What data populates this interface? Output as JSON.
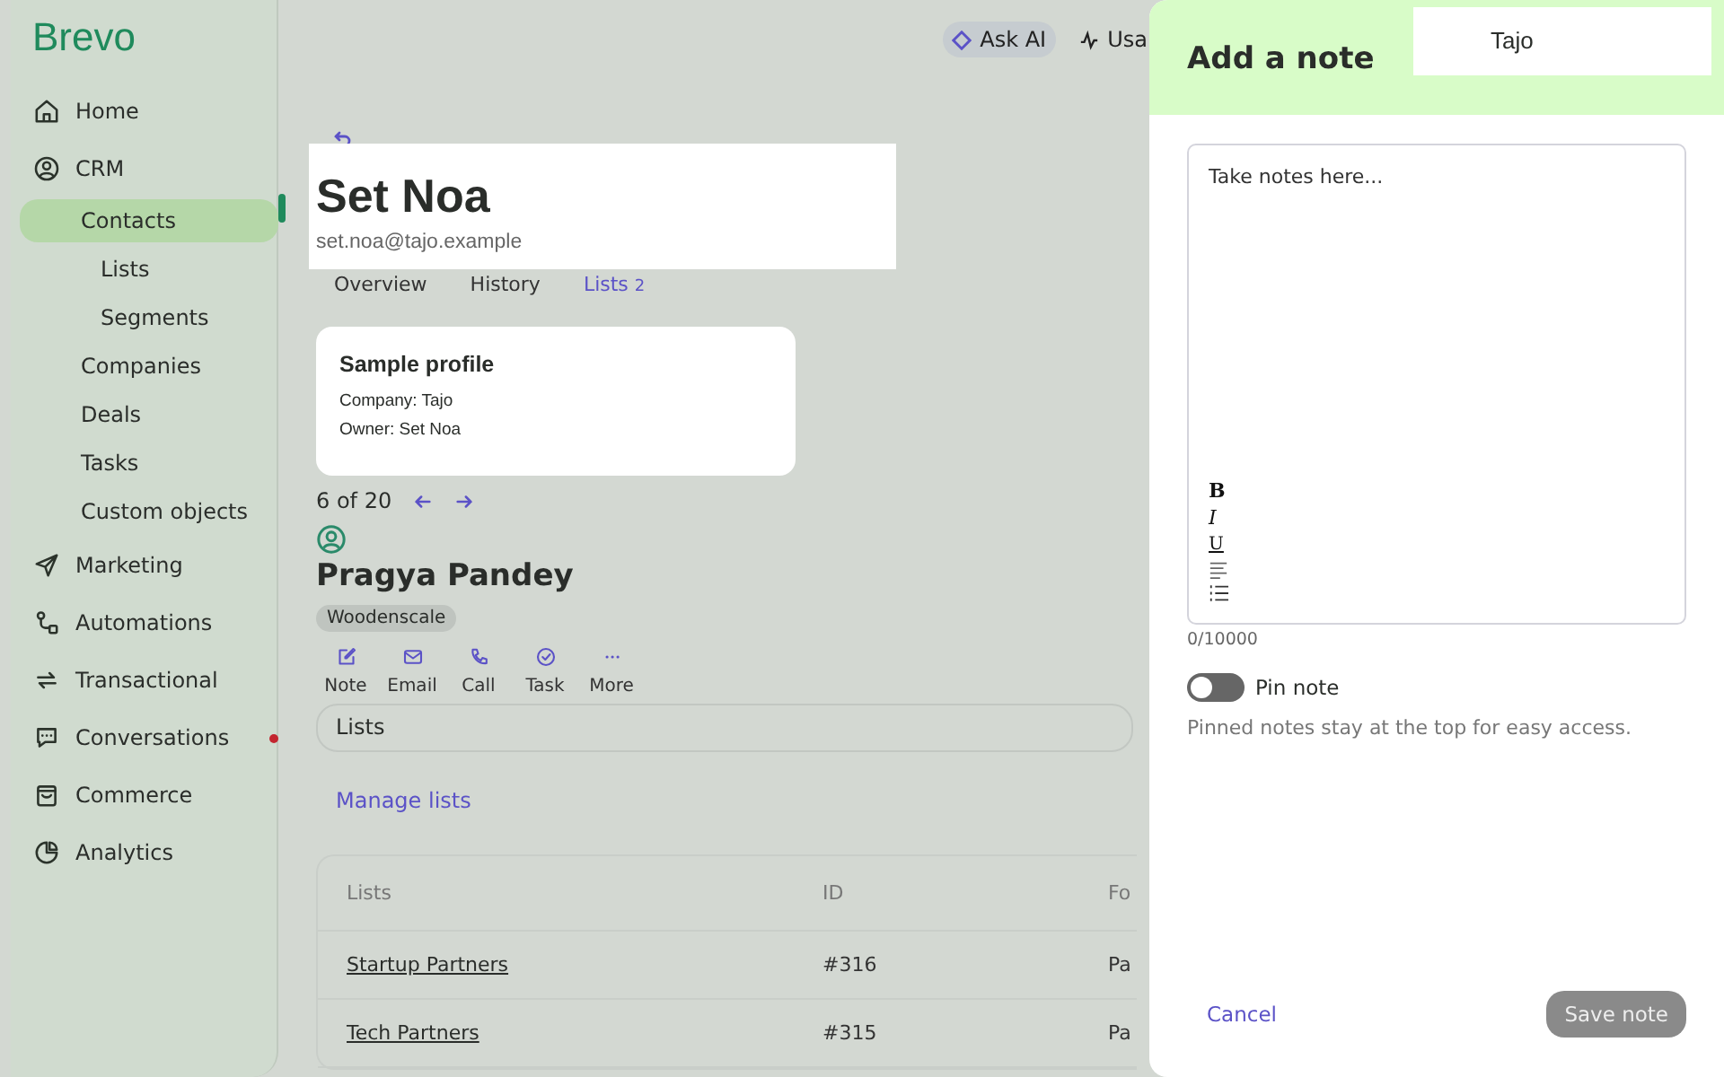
{
  "sidebar": {
    "logo": "Brevo",
    "items": [
      {
        "label": "Home",
        "selected": false
      },
      {
        "label": "CRM",
        "selected": false,
        "children": [
          {
            "label": "Contacts",
            "selected": true,
            "children": [
              {
                "label": "Lists",
                "selected": false
              },
              {
                "label": "Segments",
                "selected": false
              }
            ]
          },
          {
            "label": "Companies",
            "selected": false
          },
          {
            "label": "Deals",
            "selected": false
          },
          {
            "label": "Tasks",
            "selected": false
          },
          {
            "label": "Custom objects",
            "selected": false
          }
        ]
      },
      {
        "label": "Marketing",
        "selected": false
      },
      {
        "label": "Automations",
        "selected": false
      },
      {
        "label": "Transactional",
        "selected": false
      },
      {
        "label": "Conversations",
        "selected": false,
        "unread": true
      },
      {
        "label": "Commerce",
        "selected": false
      },
      {
        "label": "Analytics",
        "selected": false
      }
    ]
  },
  "topbar": {
    "ask_ai": "Ask AI",
    "usage": "Usa"
  },
  "profile_header": {
    "name": "Set Noa",
    "email": "set.noa@tajo.example"
  },
  "tabs": [
    {
      "label": "Overview",
      "selected": false
    },
    {
      "label": "History",
      "selected": false
    },
    {
      "label": "Lists",
      "count": "2",
      "selected": true
    }
  ],
  "sample_card": {
    "title": "Sample profile",
    "lines": [
      "Company: Tajo",
      "Owner: Set Noa"
    ]
  },
  "pager": "6 of 20",
  "contact": {
    "name": "Pragya Pandey",
    "tag": "Woodenscale",
    "actions": [
      {
        "label": "Note"
      },
      {
        "label": "Email"
      },
      {
        "label": "Call"
      },
      {
        "label": "Task"
      },
      {
        "label": "More"
      }
    ]
  },
  "lists_section": {
    "title": "Lists",
    "manage_link": "Manage lists"
  },
  "table": {
    "columns": [
      "Lists",
      "ID",
      "Fo"
    ],
    "rows": [
      [
        "Startup Partners",
        "#316",
        "Pa"
      ],
      [
        "Tech Partners",
        "#315",
        "Pa"
      ]
    ]
  },
  "note_panel": {
    "title": "Add a note",
    "company_field": "Tajo",
    "editor": {
      "placeholder": "Take notes here...",
      "toolbar": [
        {
          "kind": "bold",
          "label": "B"
        },
        {
          "kind": "italic",
          "label": "I"
        },
        {
          "kind": "underline",
          "label": "U"
        },
        {
          "kind": "align"
        },
        {
          "kind": "list"
        }
      ]
    },
    "counter": "0/10000",
    "pin": {
      "label": "Pin note",
      "on": false
    },
    "hint": "Pinned notes stay at the top for easy access.",
    "cancel": "Cancel",
    "save": {
      "label": "Save note",
      "disabled": true
    }
  }
}
